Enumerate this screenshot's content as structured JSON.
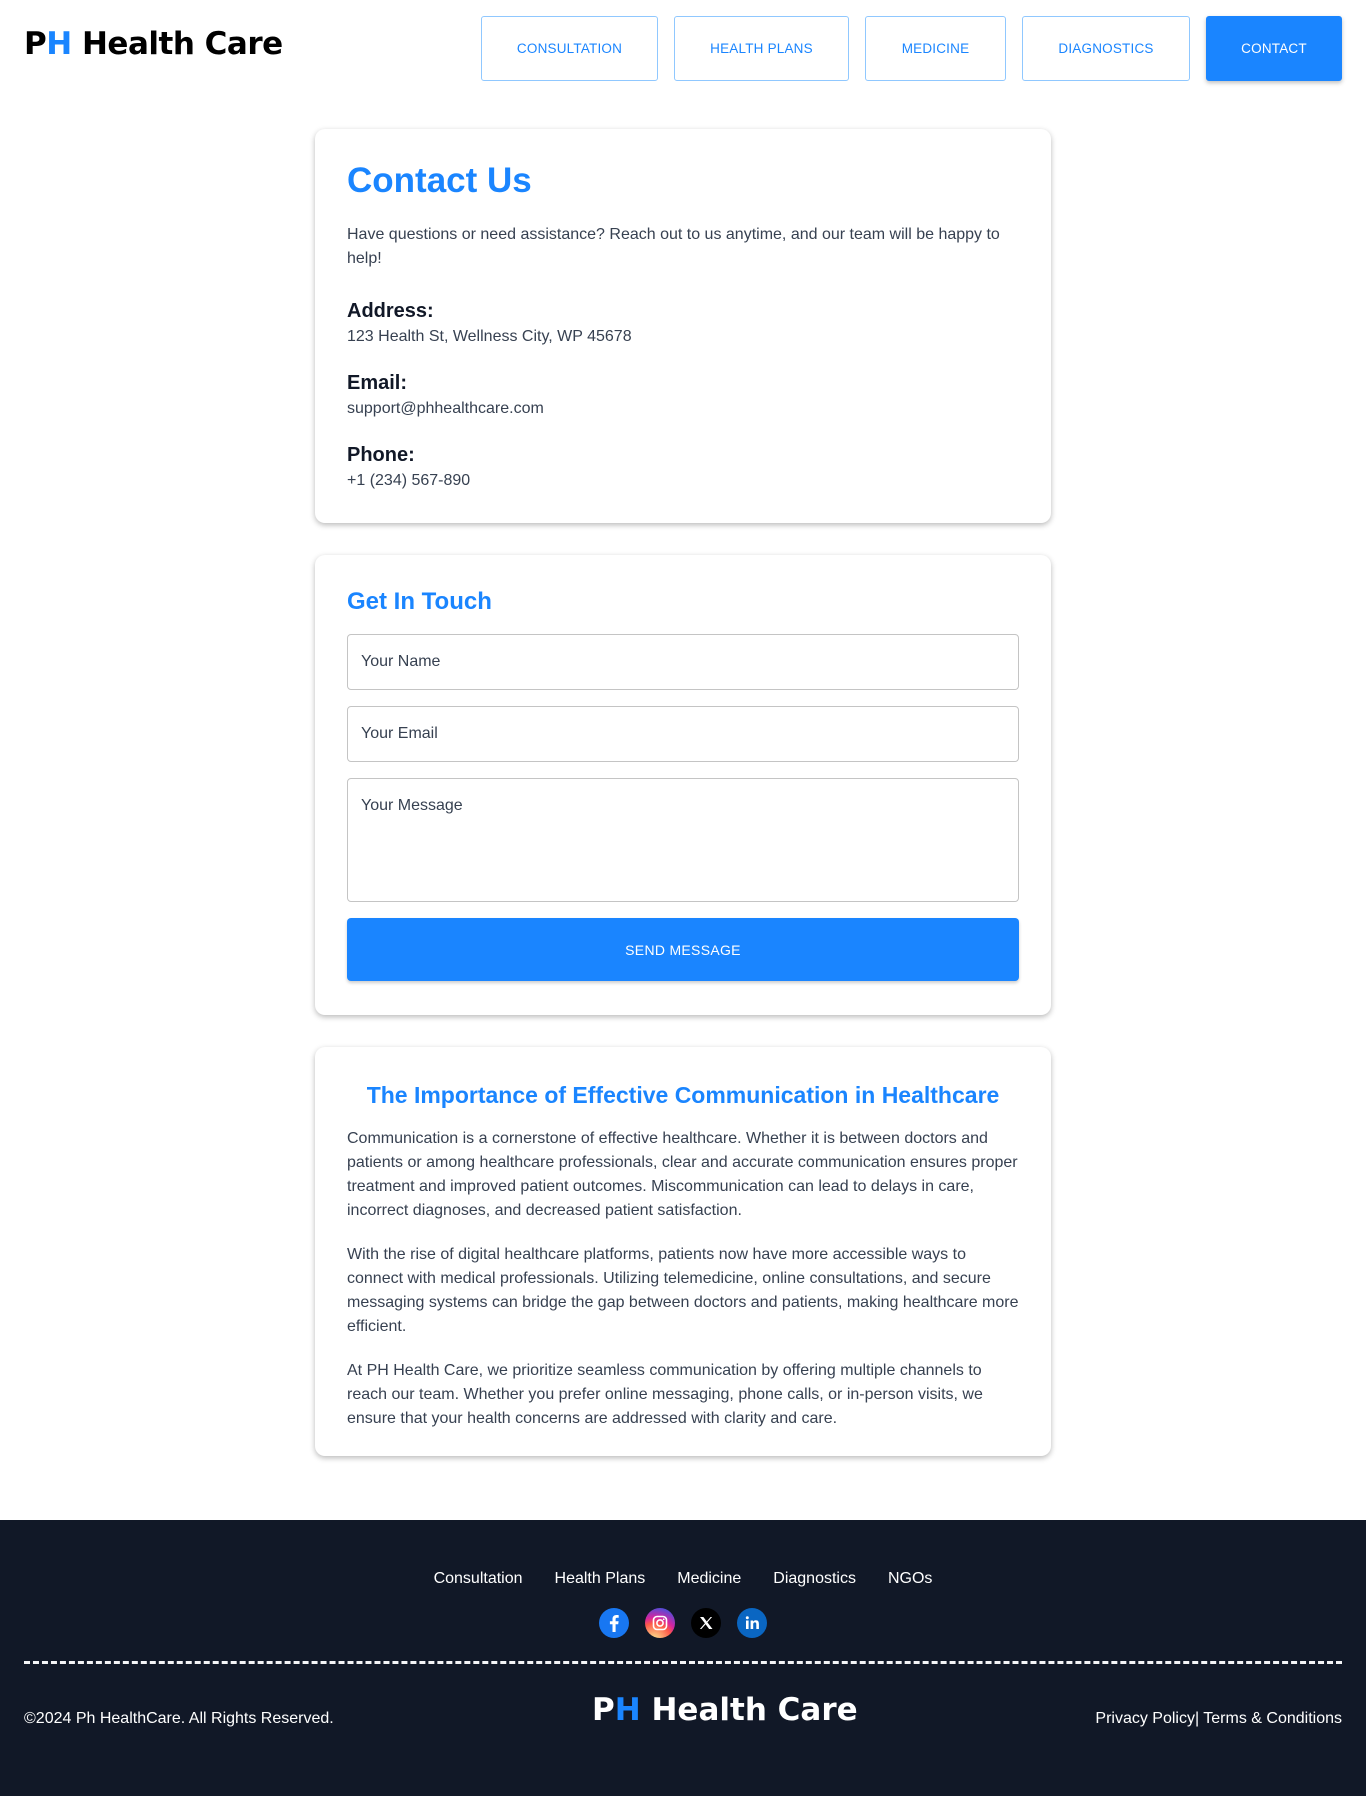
{
  "header": {
    "logo_p": "P",
    "logo_h": "H",
    "logo_rest": " Health Care",
    "nav": [
      "CONSULTATION",
      "HEALTH PLANS",
      "MEDICINE",
      "DIAGNOSTICS",
      "CONTACT"
    ],
    "active_nav": "CONTACT"
  },
  "contact": {
    "title": "Contact Us",
    "intro": "Have questions or need assistance? Reach out to us anytime, and our team will be happy to help!",
    "address_label": "Address:",
    "address": "123 Health St, Wellness City, WP 45678",
    "email_label": "Email:",
    "email": "support@phhealthcare.com",
    "phone_label": "Phone:",
    "phone": "+1 (234) 567-890"
  },
  "form": {
    "title": "Get In Touch",
    "name_placeholder": "Your Name",
    "email_placeholder": "Your Email",
    "message_placeholder": "Your Message",
    "submit_label": "SEND MESSAGE"
  },
  "article": {
    "title": "The Importance of Effective Communication in Healthcare",
    "paragraphs": [
      "Communication is a cornerstone of effective healthcare. Whether it is between doctors and patients or among healthcare professionals, clear and accurate communication ensures proper treatment and improved patient outcomes. Miscommunication can lead to delays in care, incorrect diagnoses, and decreased patient satisfaction.",
      "With the rise of digital healthcare platforms, patients now have more accessible ways to connect with medical professionals. Utilizing telemedicine, online consultations, and secure messaging systems can bridge the gap between doctors and patients, making healthcare more efficient.",
      "At PH Health Care, we prioritize seamless communication by offering multiple channels to reach our team. Whether you prefer online messaging, phone calls, or in-person visits, we ensure that your health concerns are addressed with clarity and care."
    ]
  },
  "footer": {
    "links": [
      "Consultation",
      "Health Plans",
      "Medicine",
      "Diagnostics",
      "NGOs"
    ],
    "socials": [
      "facebook-icon",
      "instagram-icon",
      "x-icon",
      "linkedin-icon"
    ],
    "copyright": "©2024 Ph HealthCare. All Rights Reserved.",
    "logo_p": "P",
    "logo_h": "H",
    "logo_rest": " Health Care",
    "legal": "Privacy Policy| Terms & Conditions"
  },
  "colors": {
    "accent": "#1a85ff",
    "footer_bg": "#111827",
    "text": "#374151"
  }
}
